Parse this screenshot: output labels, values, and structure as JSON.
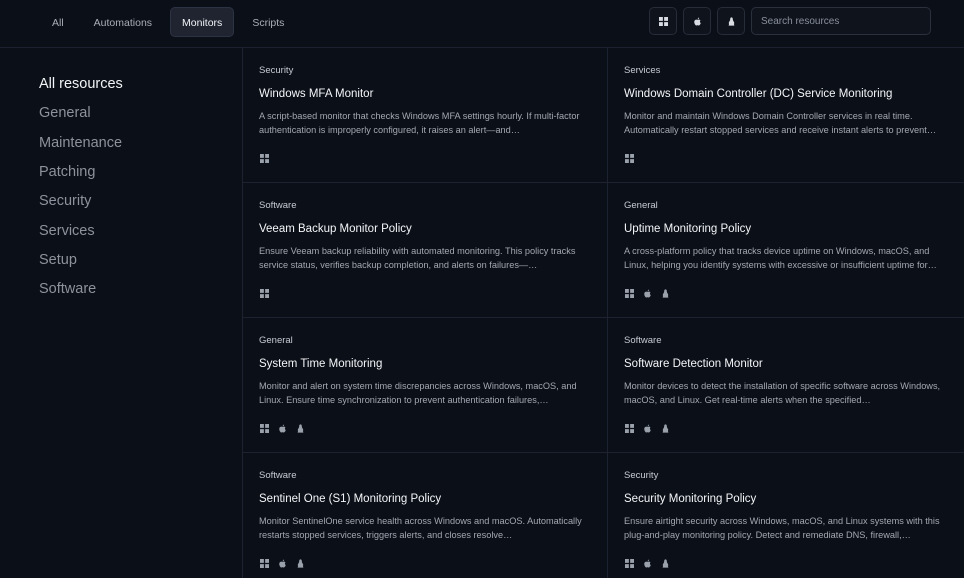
{
  "tabs": [
    {
      "label": "All",
      "active": false
    },
    {
      "label": "Automations",
      "active": false
    },
    {
      "label": "Monitors",
      "active": true
    },
    {
      "label": "Scripts",
      "active": false
    }
  ],
  "filters": {
    "windows_icon": "windows-icon",
    "apple_icon": "apple-icon",
    "linux_icon": "linux-icon"
  },
  "search": {
    "placeholder": "Search resources",
    "value": ""
  },
  "sidebar": {
    "items": [
      {
        "label": "All resources",
        "active": true
      },
      {
        "label": "General"
      },
      {
        "label": "Maintenance"
      },
      {
        "label": "Patching"
      },
      {
        "label": "Security"
      },
      {
        "label": "Services"
      },
      {
        "label": "Setup"
      },
      {
        "label": "Software"
      }
    ]
  },
  "cards": [
    {
      "category": "Security",
      "title": "Windows MFA Monitor",
      "description": "A script-based monitor that checks Windows MFA settings hourly. If multi-factor authentication is improperly configured, it raises an alert—and…",
      "platforms": [
        "windows"
      ]
    },
    {
      "category": "Services",
      "title": "Windows Domain Controller (DC) Service Monitoring",
      "description": "Monitor and maintain Windows Domain Controller services in real time. Automatically restart stopped services and receive instant alerts to prevent…",
      "platforms": [
        "windows"
      ]
    },
    {
      "category": "Software",
      "title": "Veeam Backup Monitor Policy",
      "description": "Ensure Veeam backup reliability with automated monitoring. This policy tracks service status, verifies backup completion, and alerts on failures—…",
      "platforms": [
        "windows"
      ]
    },
    {
      "category": "General",
      "title": "Uptime Monitoring Policy",
      "description": "A cross-platform policy that tracks device uptime on Windows, macOS, and Linux, helping you identify systems with excessive or insufficient uptime for…",
      "platforms": [
        "windows",
        "apple",
        "linux"
      ]
    },
    {
      "category": "General",
      "title": "System Time Monitoring",
      "description": "Monitor and alert on system time discrepancies across Windows, macOS, and Linux. Ensure time synchronization to prevent authentication failures,…",
      "platforms": [
        "windows",
        "apple",
        "linux"
      ]
    },
    {
      "category": "Software",
      "title": "Software Detection Monitor",
      "description": "Monitor devices to detect the installation of specific software across Windows, macOS, and Linux. Get real-time alerts when the specified…",
      "platforms": [
        "windows",
        "apple",
        "linux"
      ]
    },
    {
      "category": "Software",
      "title": "Sentinel One (S1) Monitoring Policy",
      "description": "Monitor SentinelOne service health across Windows and macOS. Automatically restarts stopped services, triggers alerts, and closes resolve…",
      "platforms": [
        "windows",
        "apple",
        "linux"
      ]
    },
    {
      "category": "Security",
      "title": "Security Monitoring Policy",
      "description": "Ensure airtight security across Windows, macOS, and Linux systems with this plug-and-play monitoring policy. Detect and remediate DNS, firewall,…",
      "platforms": [
        "windows",
        "apple",
        "linux"
      ]
    }
  ]
}
